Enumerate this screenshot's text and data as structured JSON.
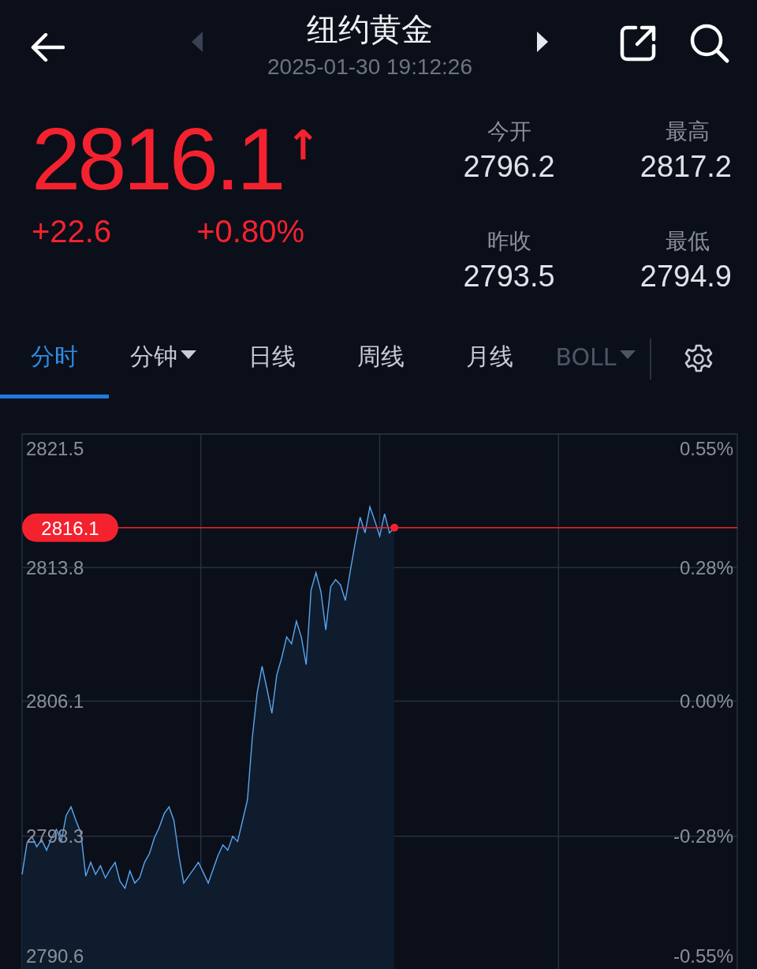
{
  "header": {
    "title": "纽约黄金",
    "timestamp": "2025-01-30 19:12:26",
    "nav": [
      {
        "kind": "prev",
        "disabled": true
      },
      {
        "kind": "next",
        "disabled": false
      }
    ]
  },
  "quote": {
    "price": "2816.1",
    "arrow": "↑",
    "change": "+22.6",
    "change_percent": "+0.80%",
    "stats": [
      {
        "label": "今开",
        "value": "2796.2"
      },
      {
        "label": "最高",
        "value": "2817.2"
      },
      {
        "label": "昨收",
        "value": "2793.5"
      },
      {
        "label": "最低",
        "value": "2794.9"
      }
    ]
  },
  "tabs": [
    {
      "label": "分时",
      "selected": true,
      "dropdown": false,
      "disabled": false
    },
    {
      "label": "分钟",
      "selected": false,
      "dropdown": true,
      "disabled": false
    },
    {
      "label": "日线",
      "selected": false,
      "dropdown": false,
      "disabled": false
    },
    {
      "label": "周线",
      "selected": false,
      "dropdown": false,
      "disabled": false
    },
    {
      "label": "月线",
      "selected": false,
      "dropdown": false,
      "disabled": false
    },
    {
      "label": "BOLL",
      "selected": false,
      "dropdown": true,
      "disabled": true
    }
  ],
  "chart": {
    "percent_labels": [
      "0.55%",
      "0.28%",
      "0.00%",
      "-0.28%",
      "-0.55%"
    ],
    "chart_data": {
      "type": "area",
      "grid": true,
      "ylim": [
        2790.6,
        2821.5
      ],
      "ref_lines": [
        {
          "axis": "y",
          "value": 2816.1,
          "color": "#f4222f",
          "label": "2816.1"
        }
      ],
      "yticks": [
        {
          "value": 2821.5,
          "label": "2821.5"
        },
        {
          "value": 2813.8,
          "label": "2813.8"
        },
        {
          "value": 2806.1,
          "label": "2806.1"
        },
        {
          "value": 2798.3,
          "label": "2798.3"
        },
        {
          "value": 2790.6,
          "label": "2790.6"
        }
      ],
      "series": [
        {
          "color": "#5aa6ee",
          "values": [
            2796.1,
            2797.9,
            2798.3,
            2797.7,
            2798.1,
            2797.5,
            2798.2,
            2798.7,
            2798.0,
            2799.5,
            2800.0,
            2799.2,
            2798.5,
            2796.0,
            2796.8,
            2796.1,
            2796.6,
            2795.9,
            2796.4,
            2796.8,
            2795.7,
            2795.3,
            2796.3,
            2795.6,
            2795.9,
            2796.8,
            2797.3,
            2798.2,
            2798.8,
            2799.6,
            2800.0,
            2799.2,
            2797.2,
            2795.6,
            2796.0,
            2796.4,
            2796.8,
            2796.2,
            2795.6,
            2796.4,
            2797.2,
            2797.8,
            2797.5,
            2798.3,
            2798.0,
            2799.2,
            2800.4,
            2804.0,
            2806.6,
            2808.1,
            2806.8,
            2805.4,
            2807.6,
            2808.6,
            2809.8,
            2809.4,
            2810.7,
            2809.8,
            2808.2,
            2812.5,
            2813.5,
            2812.4,
            2810.2,
            2812.7,
            2813.1,
            2812.8,
            2811.9,
            2813.6,
            2815.2,
            2816.7,
            2815.8,
            2817.3,
            2816.5,
            2815.6,
            2816.9,
            2815.8,
            2816.1
          ]
        }
      ]
    }
  }
}
